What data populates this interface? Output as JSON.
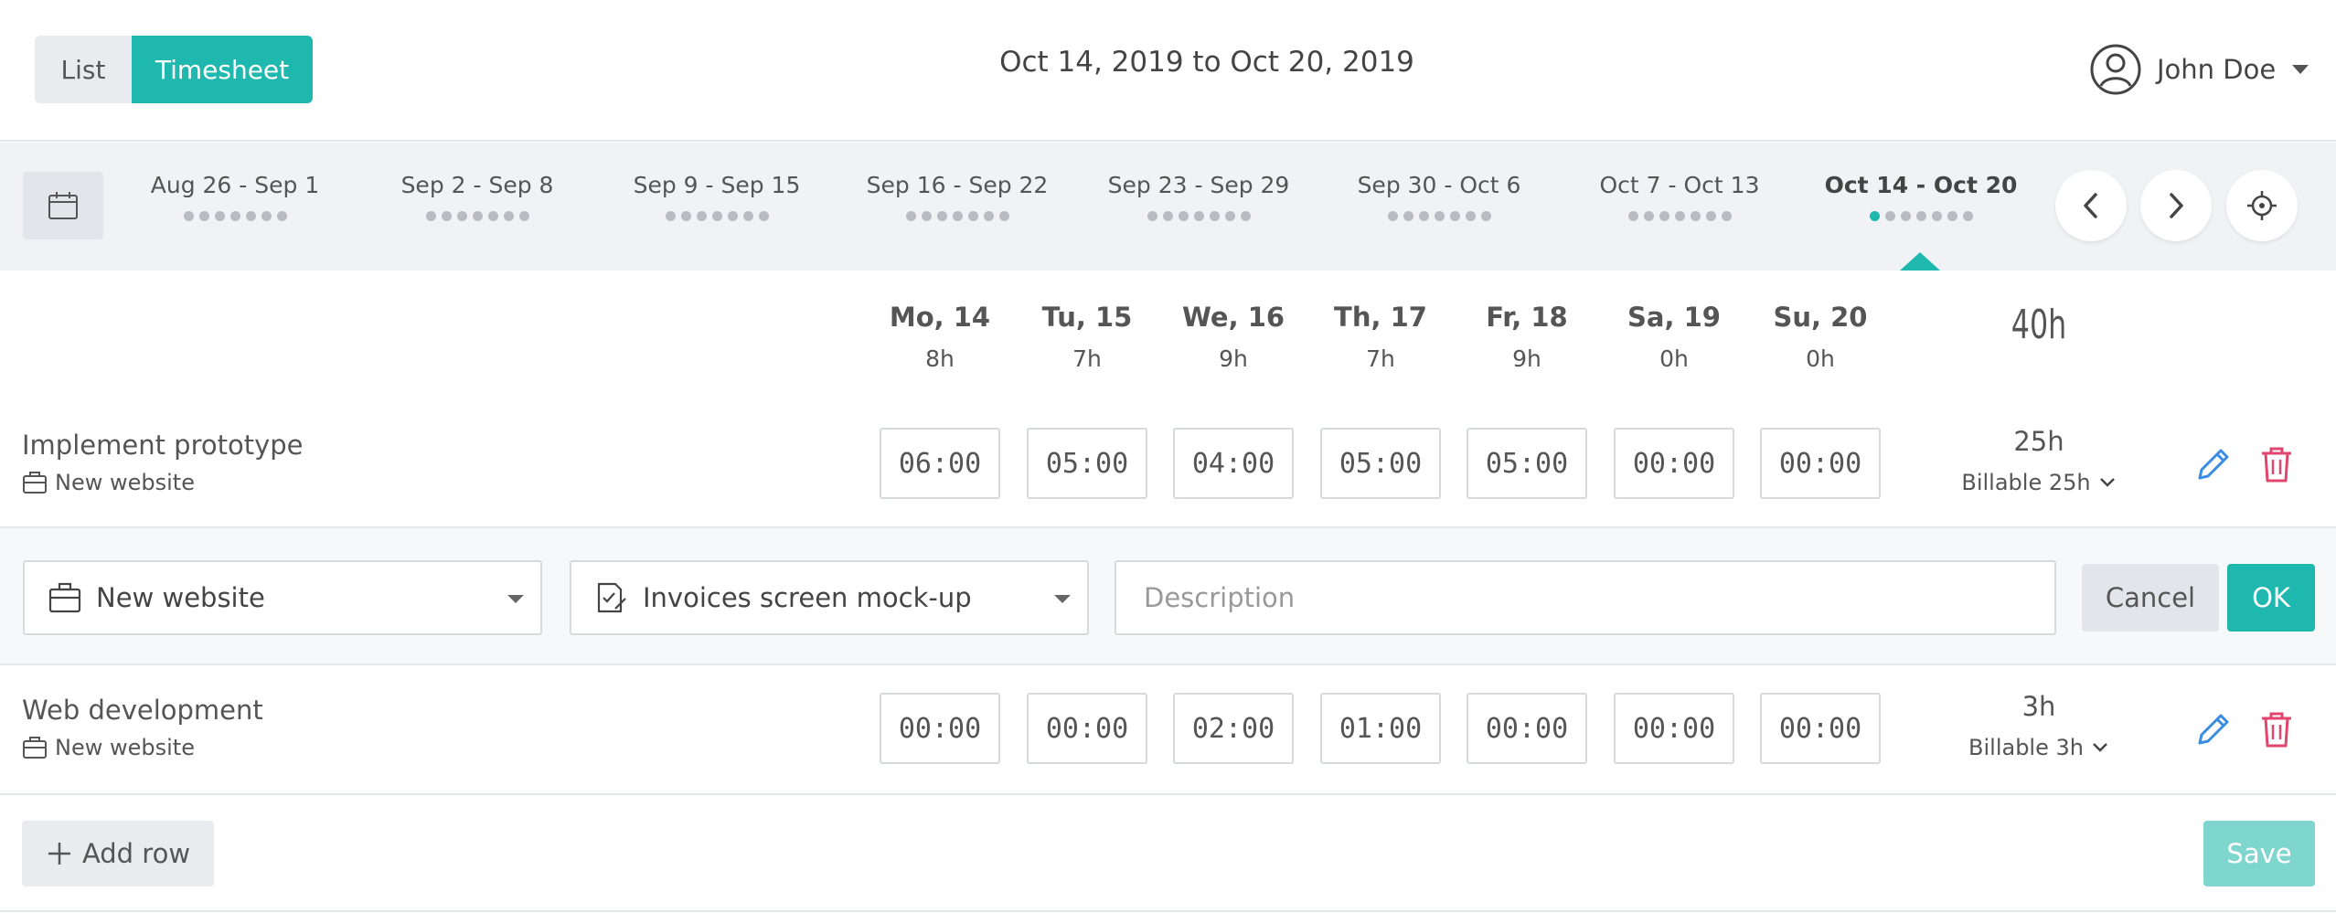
{
  "header": {
    "view_options": [
      "List",
      "Timesheet"
    ],
    "active_view": "Timesheet",
    "range_title": "Oct 14, 2019 to Oct 20, 2019",
    "user_name": "John Doe",
    "accent_color": "#1fb8ae"
  },
  "weeks": [
    {
      "label": "Aug 26 - Sep 1"
    },
    {
      "label": "Sep 2 - Sep 8"
    },
    {
      "label": "Sep 9 - Sep 15"
    },
    {
      "label": "Sep 16 - Sep 22"
    },
    {
      "label": "Sep 23 - Sep 29"
    },
    {
      "label": "Sep 30 - Oct 6"
    },
    {
      "label": "Oct 7 - Oct 13"
    },
    {
      "label": "Oct 14 - Oct 20",
      "active": true
    }
  ],
  "days": [
    {
      "name": "Mo, 14",
      "hours": "8h"
    },
    {
      "name": "Tu, 15",
      "hours": "7h"
    },
    {
      "name": "We, 16",
      "hours": "9h"
    },
    {
      "name": "Th, 17",
      "hours": "7h"
    },
    {
      "name": "Fr, 18",
      "hours": "9h"
    },
    {
      "name": "Sa, 19",
      "hours": "0h"
    },
    {
      "name": "Su, 20",
      "hours": "0h"
    }
  ],
  "grand_total": "40h",
  "rows": [
    {
      "task": "Implement prototype",
      "project": "New website",
      "times": [
        "06:00",
        "05:00",
        "04:00",
        "05:00",
        "05:00",
        "00:00",
        "00:00"
      ],
      "total": "25h",
      "billable": "Billable 25h"
    },
    {
      "task": "Web development",
      "project": "New website",
      "times": [
        "00:00",
        "00:00",
        "02:00",
        "01:00",
        "00:00",
        "00:00",
        "00:00"
      ],
      "total": "3h",
      "billable": "Billable 3h"
    }
  ],
  "editor": {
    "project_value": "New website",
    "task_value": "Invoices screen mock-up",
    "description_placeholder": "Description",
    "cancel_label": "Cancel",
    "ok_label": "OK"
  },
  "footer": {
    "add_row_label": "Add row",
    "save_label": "Save"
  },
  "icons": {
    "calendar": "calendar-icon",
    "prev": "chevron-left-icon",
    "next": "chevron-right-icon",
    "today": "crosshair-icon",
    "edit": "pencil-icon",
    "delete": "trash-icon",
    "project": "briefcase-icon",
    "task": "task-checklist-icon",
    "add": "plus-icon",
    "user": "user-circle-icon"
  },
  "colors": {
    "edit_icon": "#3a8de0",
    "delete_icon": "#e0466e",
    "save_disabled": "#7fd6cf"
  }
}
